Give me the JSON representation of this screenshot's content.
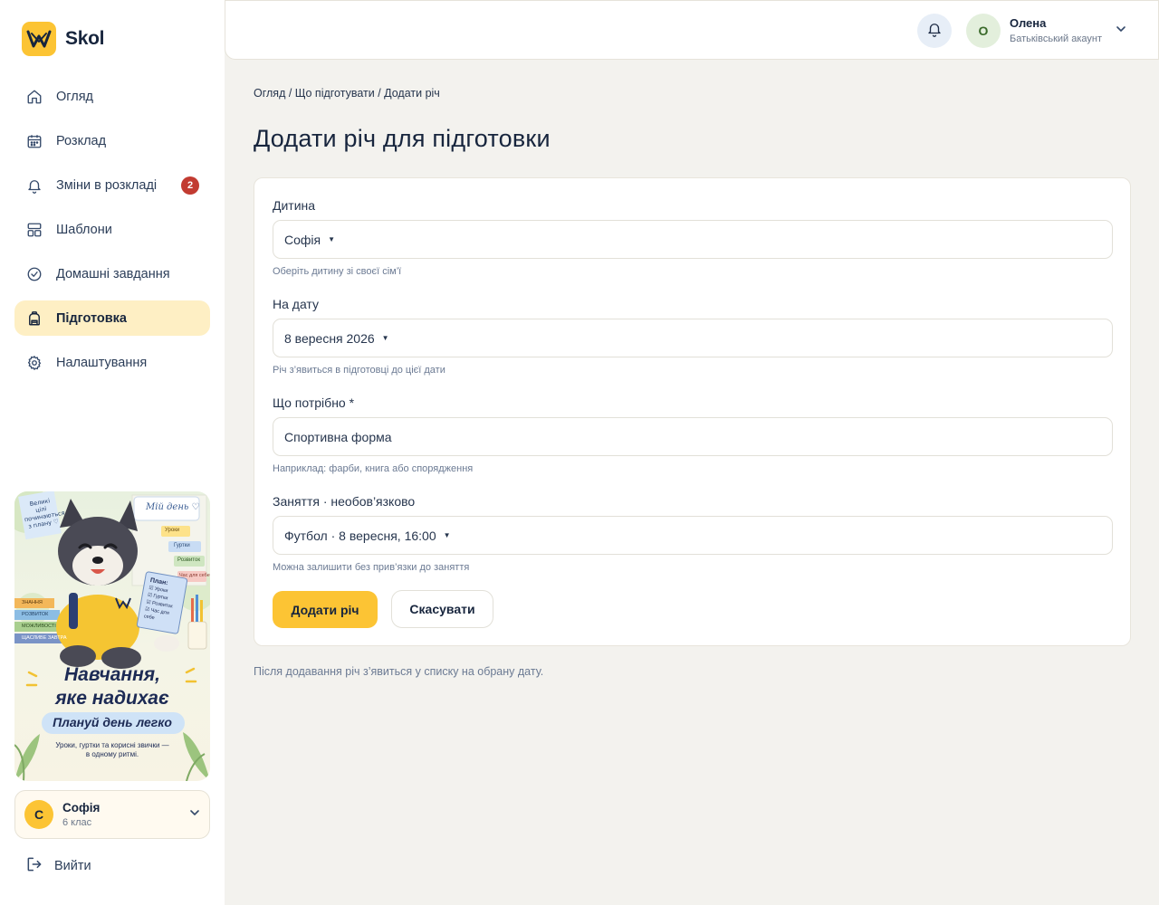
{
  "brand": {
    "name": "Skol",
    "accent": "#fcc434"
  },
  "sidebar": {
    "items": [
      {
        "label": "Огляд",
        "icon": "home-icon"
      },
      {
        "label": "Розклад",
        "icon": "calendar-icon"
      },
      {
        "label": "Зміни в розкладі",
        "icon": "bell-icon",
        "badge": "2"
      },
      {
        "label": "Шаблони",
        "icon": "layout-icon"
      },
      {
        "label": "Домашні завдання",
        "icon": "check-circle-icon"
      },
      {
        "label": "Підготовка",
        "icon": "backpack-icon",
        "active": true
      },
      {
        "label": "Налаштування",
        "icon": "gear-icon"
      }
    ],
    "promo": {
      "title_line1": "Навчання,",
      "title_line2": "яке надихає",
      "subtitle": "Плануй день легко",
      "caption_line1": "Уроки, гуртки та корисні звички —",
      "caption_line2": "в одному ритмі.",
      "sticky_note": [
        "Великі",
        "цілі",
        "починаються",
        "з плану ♡"
      ],
      "board_title": "Мій день ♡",
      "board_tags": [
        "Уроки",
        "Гуртки",
        "Розвиток",
        "Час для себе"
      ],
      "notebook_title": "План:",
      "notebook_items": [
        "☑ Уроки",
        "☑ Гуртки",
        "☑ Розвиток",
        "☑ Час для себе"
      ],
      "books": [
        "ЗНАННЯ",
        "РОЗВИТОК",
        "МОЖЛИВОСТІ",
        "ЩАСЛИВЕ ЗАВТРА"
      ]
    },
    "child": {
      "initial": "С",
      "name": "Софія",
      "grade": "6 клас"
    },
    "logout_label": "Вийти"
  },
  "topbar": {
    "user": {
      "initial": "О",
      "name": "Олена",
      "role": "Батьківський акаунт"
    }
  },
  "main": {
    "breadcrumb": "Огляд / Що підготувати / Додати річ",
    "title": "Додати річ для підготовки",
    "form": {
      "child": {
        "label": "Дитина",
        "value": "Софія",
        "hint": "Оберіть дитину зі своєї сім’ї"
      },
      "date": {
        "label": "На дату",
        "value": "8 вересня 2026",
        "hint": "Річ з’явиться в підготовці до цієї дати"
      },
      "item": {
        "label": "Що потрібно *",
        "value": "Спортивна форма",
        "hint": "Наприклад: фарби, книга або спорядження"
      },
      "activity": {
        "label": "Заняття · необов’язково",
        "value": "Футбол · 8 вересня, 16:00",
        "hint": "Можна залишити без прив’язки до заняття"
      },
      "submit_label": "Додати річ",
      "cancel_label": "Скасувати"
    },
    "footnote": "Після додавання річ з’явиться у списку на обрану дату."
  }
}
